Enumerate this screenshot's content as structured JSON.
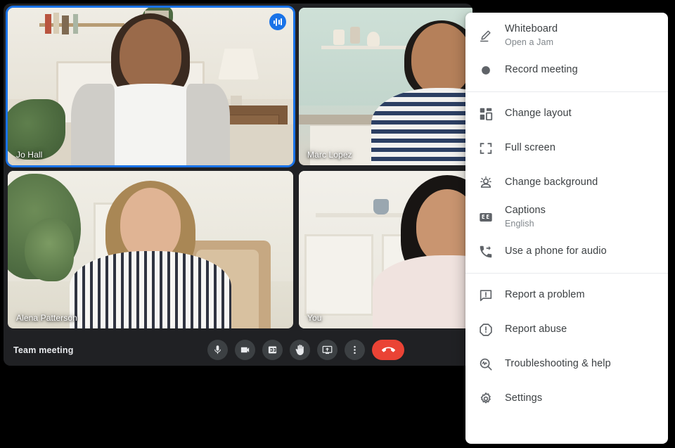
{
  "meeting": {
    "title": "Team meeting",
    "participants": [
      {
        "name": "Jo Hall",
        "badge": "speaking-indicator-icon",
        "active": true,
        "scene": "A"
      },
      {
        "name": "Marc Lopez",
        "badge": "mic-muted-icon",
        "active": false,
        "scene": "B"
      },
      {
        "name": "Alena Patterson",
        "badge": "",
        "active": false,
        "scene": "C"
      },
      {
        "name": "You",
        "badge": "",
        "active": false,
        "scene": "D"
      }
    ],
    "controls": [
      {
        "name": "microphone-button",
        "icon": "microphone-icon",
        "label": "Microphone"
      },
      {
        "name": "camera-button",
        "icon": "video-camera-icon",
        "label": "Camera"
      },
      {
        "name": "captions-button",
        "icon": "closed-caption-icon",
        "label": "Turn on captions"
      },
      {
        "name": "raise-hand-button",
        "icon": "raised-hand-icon",
        "label": "Raise hand"
      },
      {
        "name": "present-now-button",
        "icon": "present-screen-icon",
        "label": "Present now"
      },
      {
        "name": "more-options-button",
        "icon": "more-vertical-icon",
        "label": "More options"
      },
      {
        "name": "leave-call-button",
        "icon": "phone-hangup-icon",
        "label": "Leave call"
      }
    ]
  },
  "more_menu": {
    "groups": [
      {
        "items": [
          {
            "label": "Whiteboard",
            "sub": "Open a Jam",
            "icon": "whiteboard-pen-icon",
            "name": "menu-item-whiteboard"
          },
          {
            "label": "Record meeting",
            "sub": "",
            "icon": "record-dot-icon",
            "name": "menu-item-record-meeting"
          }
        ]
      },
      {
        "items": [
          {
            "label": "Change layout",
            "sub": "",
            "icon": "layout-grid-icon",
            "name": "menu-item-change-layout"
          },
          {
            "label": "Full screen",
            "sub": "",
            "icon": "fullscreen-icon",
            "name": "menu-item-full-screen"
          },
          {
            "label": "Change background",
            "sub": "",
            "icon": "change-background-icon",
            "name": "menu-item-change-background"
          },
          {
            "label": "Captions",
            "sub": "English",
            "icon": "closed-caption-icon",
            "name": "menu-item-captions"
          },
          {
            "label": "Use a phone for audio",
            "sub": "",
            "icon": "phone-forwarded-icon",
            "name": "menu-item-use-phone-for-audio"
          }
        ]
      },
      {
        "items": [
          {
            "label": "Report a problem",
            "sub": "",
            "icon": "report-problem-icon",
            "name": "menu-item-report-a-problem"
          },
          {
            "label": "Report abuse",
            "sub": "",
            "icon": "report-abuse-icon",
            "name": "menu-item-report-abuse"
          },
          {
            "label": "Troubleshooting & help",
            "sub": "",
            "icon": "troubleshooting-icon",
            "name": "menu-item-troubleshooting-help"
          },
          {
            "label": "Settings",
            "sub": "",
            "icon": "gear-icon",
            "name": "menu-item-settings"
          }
        ]
      }
    ]
  },
  "colors": {
    "accent_blue": "#1a73e8",
    "surface_dark": "#202124",
    "control_dark": "#3c4043",
    "end_call_red": "#ea4335",
    "menu_surface": "#ffffff",
    "text_primary": "#3c4043",
    "text_secondary": "#80868b"
  }
}
